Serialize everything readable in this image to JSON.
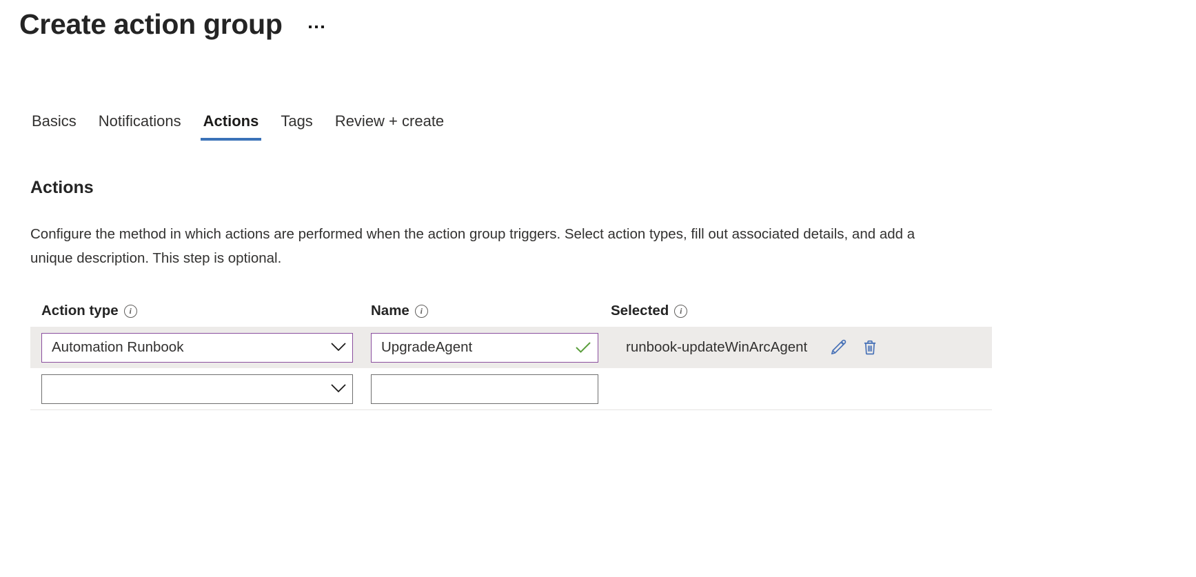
{
  "header": {
    "title": "Create action group",
    "more_menu": "…",
    "more_menu_name": "more-options"
  },
  "tabs": [
    {
      "label": "Basics",
      "active": false
    },
    {
      "label": "Notifications",
      "active": false
    },
    {
      "label": "Actions",
      "active": true
    },
    {
      "label": "Tags",
      "active": false
    },
    {
      "label": "Review + create",
      "active": false
    }
  ],
  "section": {
    "heading": "Actions",
    "description": "Configure the method in which actions are performed when the action group triggers. Select action types, fill out associated details, and add a unique description. This step is optional."
  },
  "grid": {
    "columns": {
      "action_type": "Action type",
      "name": "Name",
      "selected": "Selected"
    },
    "info_glyph": "i",
    "rows": [
      {
        "action_type": "Automation Runbook",
        "action_type_placeholder": "",
        "name": "UpgradeAgent",
        "name_placeholder": "",
        "selected": "runbook-updateWinArcAgent",
        "validated": true,
        "highlighted": true,
        "edit_label": "Edit",
        "delete_label": "Delete"
      },
      {
        "action_type": "",
        "action_type_placeholder": "",
        "name": "",
        "name_placeholder": "",
        "selected": "",
        "validated": false,
        "highlighted": false
      }
    ]
  },
  "colors": {
    "accent_tab_underline": "#3b72b8",
    "field_focus_border": "#8a4d9e",
    "field_border": "#6e6e6e",
    "row_highlight": "#edebe9",
    "validation_check": "#5a9e3c",
    "action_icon": "#4b74b8",
    "divider": "#e6e4e2"
  }
}
